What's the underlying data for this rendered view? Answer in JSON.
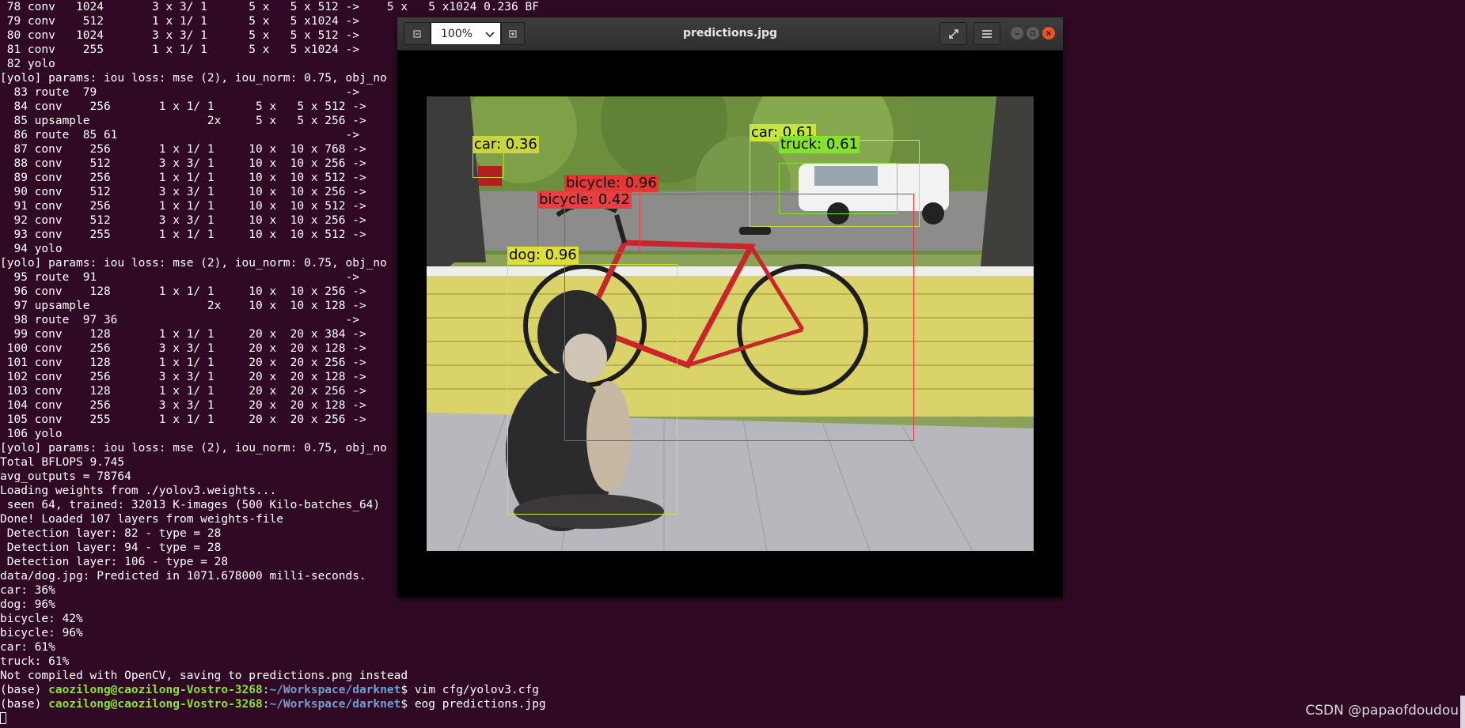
{
  "terminal": {
    "lines": [
      " 78 conv   1024       3 x 3/ 1      5 x   5 x 512 ->    5 x   5 x1024 0.236 BF",
      " 79 conv    512       1 x 1/ 1      5 x   5 x1024 ->",
      " 80 conv   1024       3 x 3/ 1      5 x   5 x 512 ->",
      " 81 conv    255       1 x 1/ 1      5 x   5 x1024 ->",
      " 82 yolo",
      "[yolo] params: iou loss: mse (2), iou_norm: 0.75, obj_no",
      "  83 route  79                                    ->",
      "  84 conv    256       1 x 1/ 1      5 x   5 x 512 ->",
      "  85 upsample                 2x     5 x   5 x 256 ->",
      "  86 route  85 61                                 ->",
      "  87 conv    256       1 x 1/ 1     10 x  10 x 768 ->",
      "  88 conv    512       3 x 3/ 1     10 x  10 x 256 ->",
      "  89 conv    256       1 x 1/ 1     10 x  10 x 512 ->",
      "  90 conv    512       3 x 3/ 1     10 x  10 x 256 ->",
      "  91 conv    256       1 x 1/ 1     10 x  10 x 512 ->",
      "  92 conv    512       3 x 3/ 1     10 x  10 x 256 ->",
      "  93 conv    255       1 x 1/ 1     10 x  10 x 512 ->",
      "  94 yolo",
      "[yolo] params: iou loss: mse (2), iou_norm: 0.75, obj_no",
      "  95 route  91                                    ->",
      "  96 conv    128       1 x 1/ 1     10 x  10 x 256 ->",
      "  97 upsample                 2x    10 x  10 x 128 ->",
      "  98 route  97 36                                 ->",
      "  99 conv    128       1 x 1/ 1     20 x  20 x 384 ->",
      " 100 conv    256       3 x 3/ 1     20 x  20 x 128 ->",
      " 101 conv    128       1 x 1/ 1     20 x  20 x 256 ->",
      " 102 conv    256       3 x 3/ 1     20 x  20 x 128 ->",
      " 103 conv    128       1 x 1/ 1     20 x  20 x 256 ->",
      " 104 conv    256       3 x 3/ 1     20 x  20 x 128 ->",
      " 105 conv    255       1 x 1/ 1     20 x  20 x 256 ->",
      " 106 yolo",
      "[yolo] params: iou loss: mse (2), iou_norm: 0.75, obj_no",
      "Total BFLOPS 9.745",
      "avg_outputs = 78764",
      "Loading weights from ./yolov3.weights...",
      " seen 64, trained: 32013 K-images (500 Kilo-batches_64)",
      "Done! Loaded 107 layers from weights-file",
      " Detection layer: 82 - type = 28",
      " Detection layer: 94 - type = 28",
      " Detection layer: 106 - type = 28",
      "data/dog.jpg: Predicted in 1071.678000 milli-seconds.",
      "car: 36%",
      "dog: 96%",
      "bicycle: 42%",
      "bicycle: 96%",
      "car: 61%",
      "truck: 61%",
      "Not compiled with OpenCV, saving to predictions.png instead"
    ],
    "prompts": [
      {
        "env": "(base) ",
        "user": "caozilong@caozilong-Vostro-3268",
        "sep": ":",
        "path": "~/Workspace/darknet",
        "dollar": "$ ",
        "cmd": "vim cfg/yolov3.cfg"
      },
      {
        "env": "(base) ",
        "user": "caozilong@caozilong-Vostro-3268",
        "sep": ":",
        "path": "~/Workspace/darknet",
        "dollar": "$ ",
        "cmd": "eog predictions.jpg"
      }
    ]
  },
  "viewer": {
    "title": "predictions.jpg",
    "zoom": "100%",
    "detections": [
      {
        "label": "car: 0.36",
        "color": "#c8d63c"
      },
      {
        "label": "car: 0.61",
        "color": "#c8e53c"
      },
      {
        "label": "truck: 0.61",
        "color": "#86e02e"
      },
      {
        "label": "bicycle: 0.96",
        "color": "#e63535"
      },
      {
        "label": "bicycle: 0.42",
        "color": "#e84040"
      },
      {
        "label": "dog: 0.96",
        "color": "#dede3a"
      }
    ]
  },
  "watermark": "CSDN @papaofdoudou",
  "colors": {
    "terminal_bg": "#300a24",
    "prompt_user": "#8ae234",
    "prompt_path": "#729fcf",
    "close": "#e95420"
  }
}
